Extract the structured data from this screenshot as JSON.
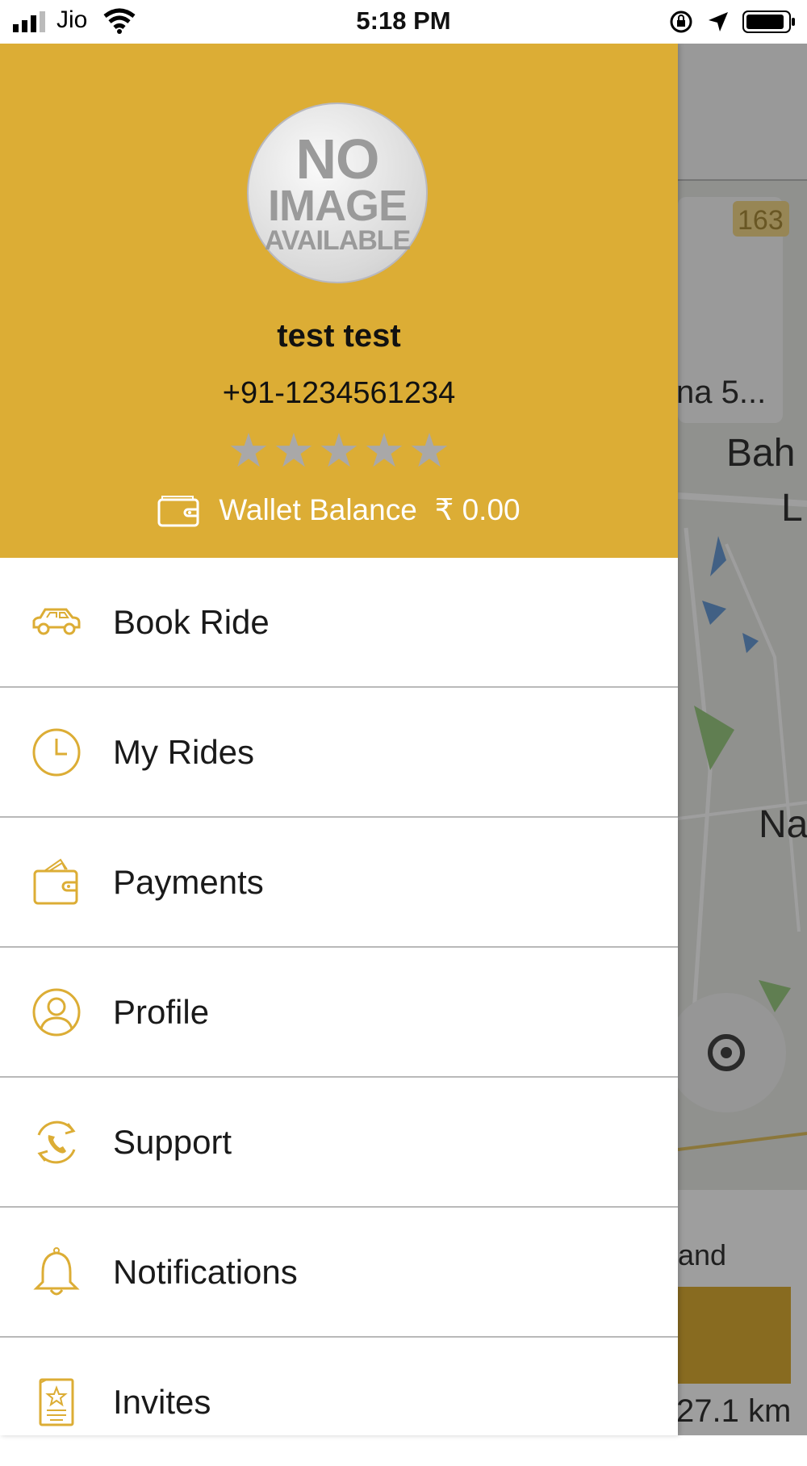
{
  "status_bar": {
    "carrier": "Jio",
    "time": "5:18 PM"
  },
  "user": {
    "avatar_lines": [
      "NO",
      "IMAGE",
      "AVAILABLE"
    ],
    "name": "test test",
    "phone": "+91-1234561234",
    "rating_stars_filled": 0,
    "rating_stars_total": 5,
    "wallet_label": "Wallet Balance",
    "wallet_amount": "₹ 0.00"
  },
  "menu": {
    "items": [
      {
        "label": "Book Ride",
        "icon": "car-icon"
      },
      {
        "label": "My Rides",
        "icon": "clock-icon"
      },
      {
        "label": "Payments",
        "icon": "wallet-icon"
      },
      {
        "label": "Profile",
        "icon": "user-icon"
      },
      {
        "label": "Support",
        "icon": "phone-refresh-icon"
      },
      {
        "label": "Notifications",
        "icon": "bell-icon"
      },
      {
        "label": "Invites",
        "icon": "invite-card-icon"
      }
    ]
  },
  "background": {
    "map_labels": [
      "163",
      "na 5...",
      "Bah",
      "L",
      "Na",
      "and",
      "27.1 km"
    ]
  },
  "colors": {
    "header_bg": "#dcad35",
    "icon_accent": "#dcad35",
    "star_empty": "#a9a8a8"
  }
}
